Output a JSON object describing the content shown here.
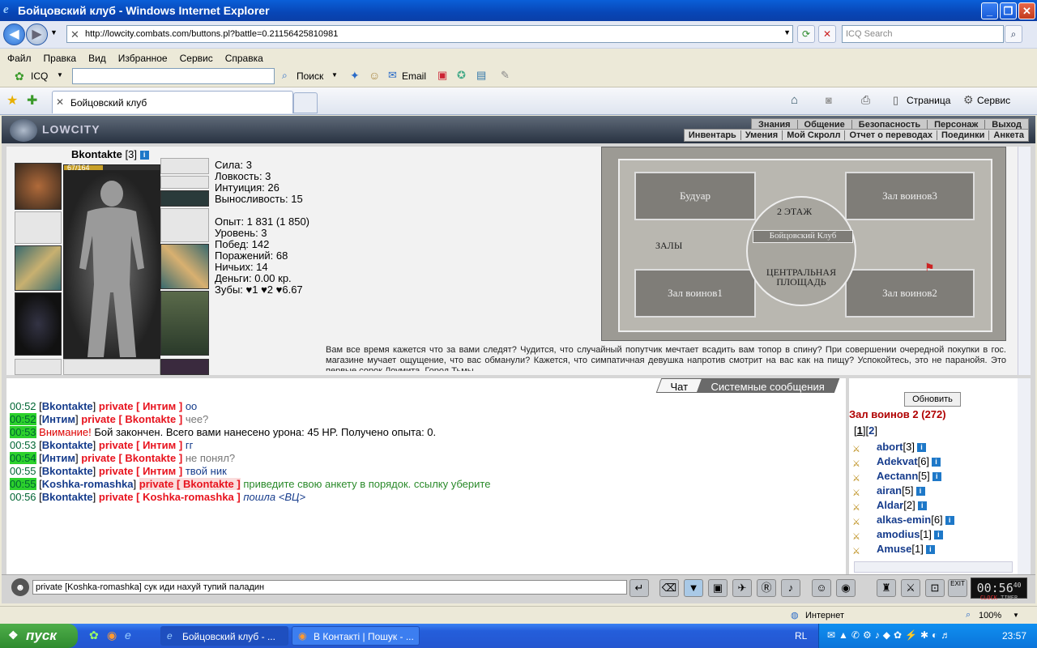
{
  "window": {
    "title": "Бойцовский клуб - Windows Internet Explorer"
  },
  "address": {
    "url": "http://lowcity.combats.com/buttons.pl?battle=0.21156425810981",
    "search_placeholder": "ICQ Search"
  },
  "menu": [
    "Файл",
    "Правка",
    "Вид",
    "Избранное",
    "Сервис",
    "Справка"
  ],
  "toolbar": {
    "icq": "ICQ",
    "search": "Поиск",
    "email": "Email"
  },
  "tabs": {
    "active": "Бойцовский клуб",
    "page": "Страница",
    "service": "Сервис"
  },
  "game": {
    "logo": "LOWCITY",
    "nav_main": [
      "Знания",
      "Общение",
      "Безопасность",
      "Персонаж",
      "Выход"
    ],
    "nav_sub": [
      "Инвентарь",
      "Умения",
      "Мой Скролл",
      "Отчет о переводах",
      "Поединки",
      "Анкета"
    ],
    "character": {
      "name": "Bkontakte",
      "level": "[3]",
      "hp": "67/164",
      "hp_fraction": 0.41
    },
    "stats": [
      "Сила: 3",
      "Ловкость: 3",
      "Интуиция: 26",
      "Выносливость: 15",
      "",
      "Опыт: 1 831 (1 850)",
      "Уровень: 3",
      "Побед: 142",
      "Поражений: 68",
      "Ничьих: 14",
      "Деньги: 0.00 кр.",
      "Зубы: ♥1 ♥2 ♥6.67"
    ],
    "map": {
      "rooms": [
        "Будуар",
        "Зал воинов3",
        "2 ЭТАЖ",
        "Бойцовский Клуб",
        "ЗАЛЫ",
        "ЦЕНТРАЛЬНАЯ ПЛОЩАДЬ",
        "Зал воинов1",
        "Зал воинов2"
      ]
    },
    "quote": "Вам все время кажется что за вами следят? Чудится, что случайный попутчик мечтает всадить вам топор в спину? При совершении очередной покупки в гос. магазине мучает ощущение, что вас обманули? Кажется, что симпатичная девушка напротив смотрит на вас как на пищу? Успокойтесь, это не паранойя. Это первые сорок Лоумита. Город Тьмы.",
    "chat_tabs": [
      "Чат",
      "Системные сообщения"
    ],
    "messages": [
      {
        "time": "00:52",
        "hl": false,
        "from": "Bkontakte",
        "to": "Интим",
        "text": "оо",
        "color": "#163c8c"
      },
      {
        "time": "00:52",
        "hl": true,
        "from": "Интим",
        "to": "Bkontakte",
        "text": "чее?",
        "color": "#777777"
      },
      {
        "time": "00:53",
        "hl": true,
        "warn": "Внимание!",
        "text": "Бой закончен. Всего вами нанесено урона: 45 HP. Получено опыта: 0."
      },
      {
        "time": "00:53",
        "hl": false,
        "from": "Bkontakte",
        "to": "Интим",
        "text": "гг",
        "color": "#163c8c"
      },
      {
        "time": "00:54",
        "hl": true,
        "from": "Интим",
        "to": "Bkontakte",
        "text": "не понял?",
        "color": "#777777"
      },
      {
        "time": "00:55",
        "hl": false,
        "from": "Bkontakte",
        "to": "Интим",
        "text": "твой ник",
        "color": "#163c8c"
      },
      {
        "time": "00:55",
        "hl": true,
        "from": "Koshka-romashka",
        "to": "Bkontakte",
        "text": "приведите свою анкету в порядок. ссылку уберите",
        "color": "#2a8a2a",
        "bg": true
      },
      {
        "time": "00:56",
        "hl": false,
        "from": "Bkontakte",
        "to": "Koshka-romashka",
        "text": "пошла <ВЦ>",
        "color": "#163c8c",
        "italic": true
      }
    ],
    "room": {
      "refresh": "Обновить",
      "name": "Зал воинов 2 (272)",
      "pages": [
        "1",
        "2"
      ]
    },
    "users": [
      {
        "name": "abort",
        "level": "[3]"
      },
      {
        "name": "Adekvat",
        "level": "[6]"
      },
      {
        "name": "Aectann",
        "level": "[5]"
      },
      {
        "name": "airan",
        "level": "[5]"
      },
      {
        "name": "Aldar",
        "level": "[2]"
      },
      {
        "name": "alkas-emin",
        "level": "[6]"
      },
      {
        "name": "amodius",
        "level": "[1]"
      },
      {
        "name": "Amuse",
        "level": "[1]"
      }
    ],
    "chat_input": "private [Koshka-romashka] сук иди нахуй тупий паладин",
    "clock": "00:56",
    "clock_sec": "40",
    "clock_label": "CLOCK",
    "timer_label": "TIMER"
  },
  "status": {
    "zone": "Интернет",
    "zoom": "100%"
  },
  "taskbar": {
    "start": "пуск",
    "tasks": [
      "Бойцовский клуб - ...",
      "В Контакті | Пошук - ..."
    ],
    "lang": "RL",
    "time": "23:57"
  }
}
